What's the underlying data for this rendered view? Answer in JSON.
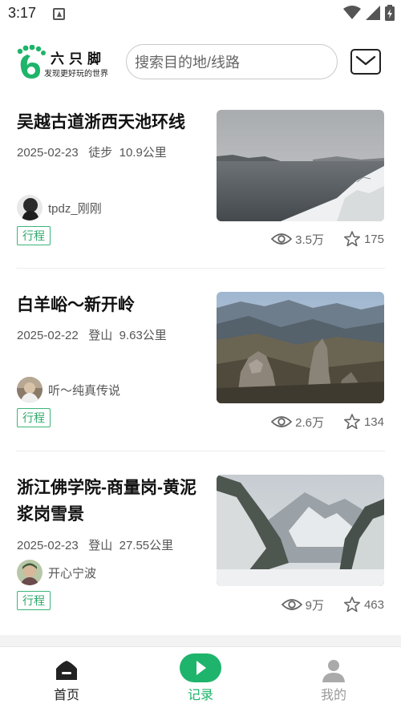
{
  "status_bar": {
    "time": "3:17"
  },
  "header": {
    "logo_name": "六只脚",
    "logo_slogan": "发现更好玩的世界",
    "search_placeholder": "搜索目的地/线路"
  },
  "records": [
    {
      "title": "吴越古道浙西天池环线",
      "date": "2025-02-23",
      "activity": "徒步",
      "distance": "10.9公里",
      "author": "tpdz_刚刚",
      "tag": "行程",
      "views": "3.5万",
      "likes": "175"
    },
    {
      "title": "白羊峪～新开岭",
      "date": "2025-02-22",
      "activity": "登山",
      "distance": "9.63公里",
      "author": "听～纯真传说",
      "tag": "行程",
      "views": "2.6万",
      "likes": "134"
    },
    {
      "title": "浙江佛学院-商量岗-黄泥浆岗雪景",
      "date": "2025-02-23",
      "activity": "登山",
      "distance": "27.55公里",
      "author": "开心宁波",
      "tag": "行程",
      "views": "9万",
      "likes": "463"
    }
  ],
  "bottom_nav": [
    {
      "label": "首页",
      "icon": "home-icon"
    },
    {
      "label": "记录",
      "icon": "play-record-icon"
    },
    {
      "label": "我的",
      "icon": "user-icon"
    }
  ],
  "colors": {
    "accent": "#1fb46b",
    "tag": "#2ea86a",
    "text": "#222222",
    "muted": "#555555"
  }
}
